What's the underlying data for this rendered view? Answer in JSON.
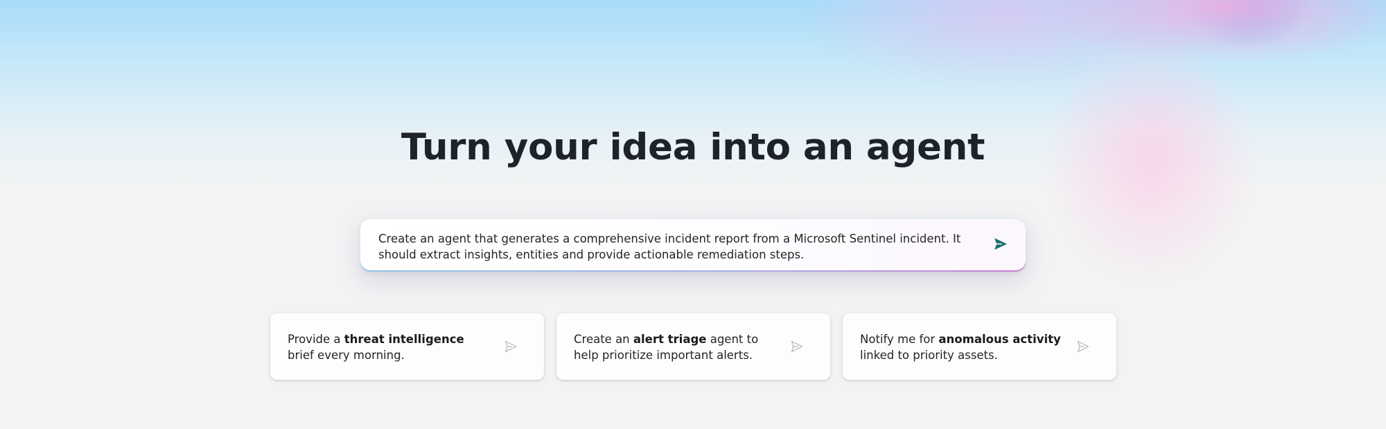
{
  "hero": {
    "title": "Turn your idea into an agent"
  },
  "prompt": {
    "text": "Create an agent that generates a comprehensive incident report from a Microsoft Sentinel incident. It should extract insights, entities and provide actionable remediation steps.",
    "send_icon": "send-icon",
    "send_color": "#1f6e6c"
  },
  "suggestions": [
    {
      "before": "Provide a ",
      "bold": "threat intelligence",
      "after": " brief every morning.",
      "icon": "send-outline-icon"
    },
    {
      "before": "Create an ",
      "bold": "alert triage",
      "after": " agent to help prioritize important alerts.",
      "icon": "send-outline-icon"
    },
    {
      "before": "Notify me for ",
      "bold": "anomalous activity",
      "after": " linked to priority assets.",
      "icon": "send-outline-icon"
    }
  ]
}
